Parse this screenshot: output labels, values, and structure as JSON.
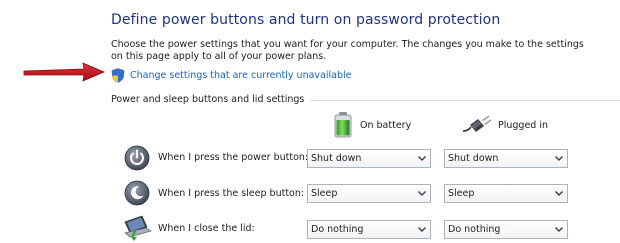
{
  "header": {
    "title": "Define power buttons and turn on password protection",
    "description": "Choose the power settings that you want for your computer. The changes you make to the settings on this page apply to all of your power plans."
  },
  "change_link": {
    "label": "Change settings that are currently unavailable",
    "icon": "uac-shield-icon"
  },
  "section": {
    "label": "Power and sleep buttons and lid settings"
  },
  "columns": [
    {
      "label": "On battery",
      "icon": "battery-icon"
    },
    {
      "label": "Plugged in",
      "icon": "power-plug-icon"
    }
  ],
  "rows": [
    {
      "label": "When I press the power button:",
      "icon": "power-button-icon",
      "on_battery": "Shut down",
      "plugged_in": "Shut down"
    },
    {
      "label": "When I press the sleep button:",
      "icon": "sleep-button-icon",
      "on_battery": "Sleep",
      "plugged_in": "Sleep"
    },
    {
      "label": "When I close the lid:",
      "icon": "laptop-lid-icon",
      "on_battery": "Do nothing",
      "plugged_in": "Do nothing"
    }
  ],
  "colors": {
    "title": "#1e3287",
    "link": "#1565c0",
    "arrow": "#c0141c"
  }
}
